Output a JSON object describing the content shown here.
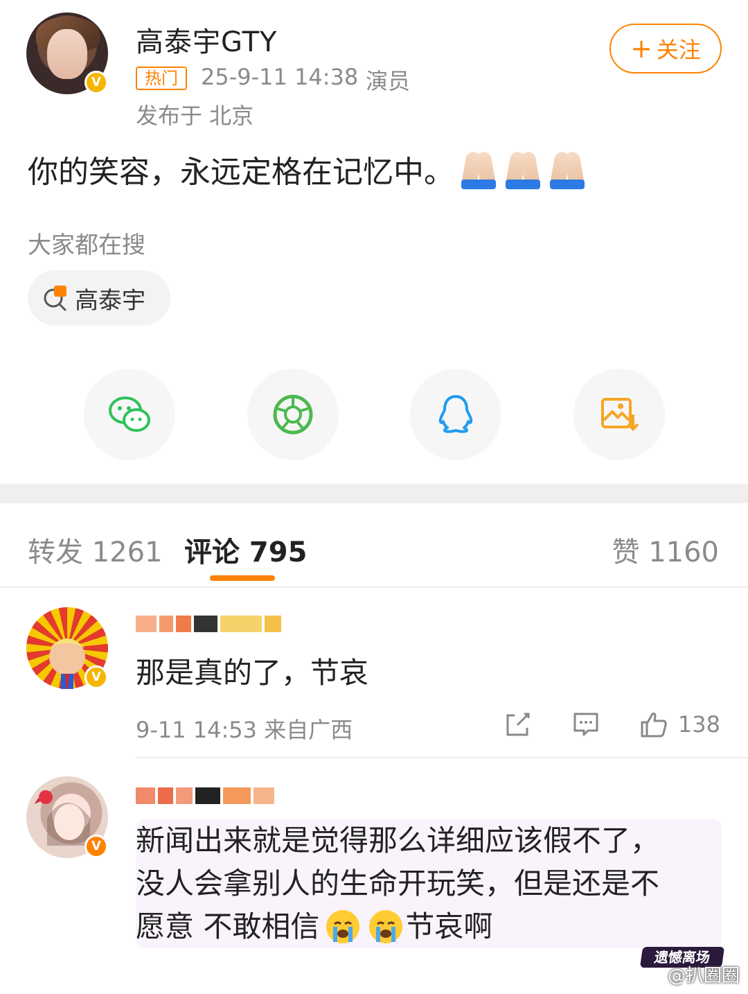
{
  "post": {
    "author_name": "高泰宇GTY",
    "hot_tag": "热门",
    "time": "25-9-11 14:38",
    "role": "演员",
    "location": "发布于 北京",
    "follow_label": "关注",
    "text": "你的笑容，永远定格在记忆中。",
    "emoji": [
      "folded-hands",
      "folded-hands",
      "folded-hands"
    ]
  },
  "search": {
    "heading": "大家都在搜",
    "chip": "高泰宇"
  },
  "share": [
    {
      "name": "wechat-icon",
      "color": "#2fc25b"
    },
    {
      "name": "moments-icon",
      "color": "#4cb850"
    },
    {
      "name": "qq-icon",
      "color": "#1e9bf0"
    },
    {
      "name": "save-image-icon",
      "color": "#f5a623"
    }
  ],
  "tabs": {
    "repost": "转发 1261",
    "comment": "评论 795",
    "like": "赞 1160"
  },
  "comments": [
    {
      "text": "那是真的了，节哀",
      "meta": "9-11 14:53 来自广西",
      "likes": "138"
    },
    {
      "text_lines": [
        "新闻出来就是觉得那么详细应该假不了，",
        "没人会拿别人的生命开玩笑，但是还是不",
        "愿意 不敢相信"
      ],
      "text_tail": "节哀啊"
    }
  ],
  "watermark": "@扒圈圈",
  "corner_logo": "遗憾离场",
  "colors": {
    "accent": "#ff8200",
    "muted": "#8a8a8a"
  }
}
